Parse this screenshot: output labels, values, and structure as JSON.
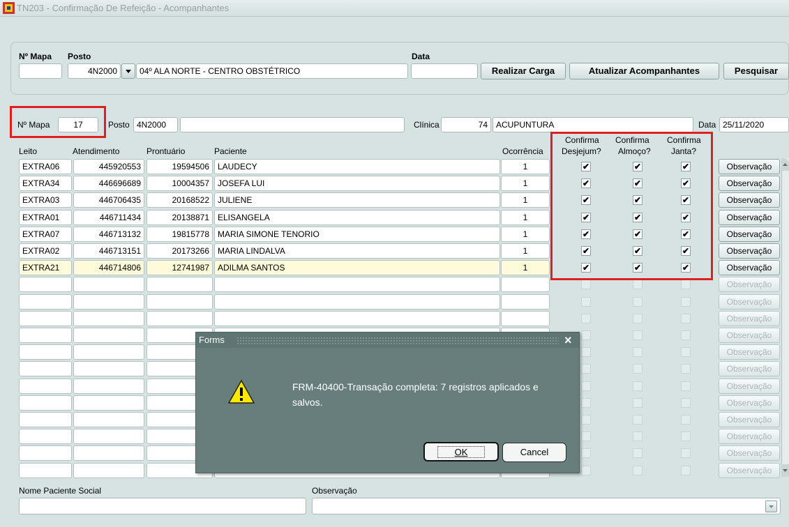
{
  "window": {
    "title": "TN203 - Confirmação De Refeição - Acompanhantes"
  },
  "filter": {
    "mapa_label": "Nº Mapa",
    "posto_label": "Posto",
    "data_label": "Data",
    "mapa_value": "",
    "posto_code": "4N2000",
    "posto_name": "04º ALA NORTE - CENTRO OBSTÉTRICO",
    "data_value": "",
    "btn_carga": "Realizar Carga",
    "btn_atualizar": "Atualizar Acompanhantes",
    "btn_pesquisar": "Pesquisar"
  },
  "header": {
    "mapa_label": "Nº Mapa",
    "mapa_value": "17",
    "posto_label": "Posto",
    "posto_code": "4N2000",
    "posto_name": "",
    "clinica_label": "Clínica",
    "clinica_code": "74",
    "clinica_name": "ACUPUNTURA",
    "data_label": "Data",
    "data_value": "25/11/2020"
  },
  "columns": {
    "leito": "Leito",
    "atendimento": "Atendimento",
    "prontuario": "Prontuário",
    "paciente": "Paciente",
    "ocorrencia": "Ocorrência",
    "desjejum": [
      "Confirma",
      "Desjejum?"
    ],
    "almoco": [
      "Confirma",
      "Almoço?"
    ],
    "janta": [
      "Confirma",
      "Janta?"
    ]
  },
  "rows": [
    {
      "leito": "EXTRA06",
      "atendimento": "445920553",
      "prontuario": "19594506",
      "paciente": "LAUDECY",
      "ocorrencia": "1",
      "d": true,
      "a": true,
      "j": true
    },
    {
      "leito": "EXTRA34",
      "atendimento": "446696689",
      "prontuario": "10004357",
      "paciente": "JOSEFA LUI",
      "ocorrencia": "1",
      "d": true,
      "a": true,
      "j": true
    },
    {
      "leito": "EXTRA03",
      "atendimento": "446706435",
      "prontuario": "20168522",
      "paciente": "JULIENE",
      "ocorrencia": "1",
      "d": true,
      "a": true,
      "j": true
    },
    {
      "leito": "EXTRA01",
      "atendimento": "446711434",
      "prontuario": "20138871",
      "paciente": "ELISANGELA",
      "ocorrencia": "1",
      "d": true,
      "a": true,
      "j": true
    },
    {
      "leito": "EXTRA07",
      "atendimento": "446713132",
      "prontuario": "19815778",
      "paciente": "MARIA SIMONE TENORIO",
      "ocorrencia": "1",
      "d": true,
      "a": true,
      "j": true
    },
    {
      "leito": "EXTRA02",
      "atendimento": "446713151",
      "prontuario": "20173266",
      "paciente": "MARIA LINDALVA",
      "ocorrencia": "1",
      "d": true,
      "a": true,
      "j": true
    },
    {
      "leito": "EXTRA21",
      "atendimento": "446714806",
      "prontuario": "12741987",
      "paciente": "ADILMA SANTOS",
      "ocorrencia": "1",
      "d": true,
      "a": true,
      "j": true
    }
  ],
  "empty_rows": 12,
  "obs_button_label": "Observação",
  "footer": {
    "nome_social_label": "Nome Paciente Social",
    "observacao_label": "Observação"
  },
  "dialog": {
    "title": "Forms",
    "message": "FRM-40400-Transação completa: 7 registros aplicados e salvos.",
    "ok_label": "OK",
    "cancel_label": "Cancel"
  },
  "colors": {
    "highlight": "#e02020",
    "selected_row": "#fdfbd9",
    "background": "#d7e3e2"
  },
  "icons": {
    "check": "✔",
    "warning": "warning-icon",
    "close": "×"
  }
}
